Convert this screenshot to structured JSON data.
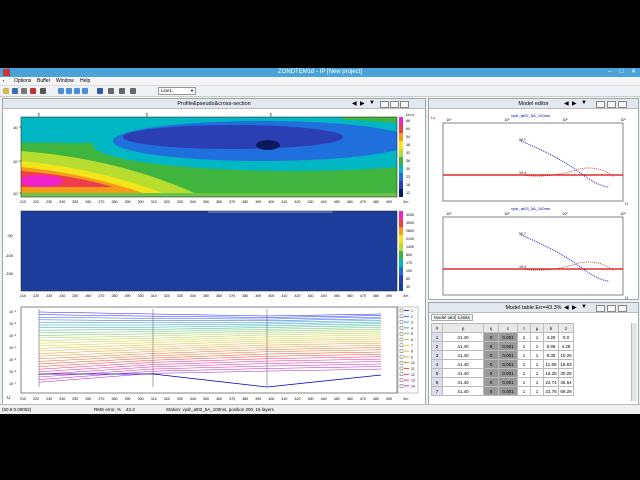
{
  "window": {
    "title": "ZONDTEM1d - IP [New project]",
    "min": "–",
    "max": "□",
    "close": "✕"
  },
  "menu": {
    "items": [
      "Options",
      "Buffer",
      "Window",
      "Help"
    ]
  },
  "toolbar": {
    "line_combo": "Line1"
  },
  "profile_panel": {
    "title": "Profile&pseudo&cross-section",
    "x_ticks": [
      "210",
      "220",
      "230",
      "240",
      "250",
      "260",
      "270",
      "280",
      "290",
      "300",
      "310",
      "320",
      "330",
      "340",
      "350",
      "360",
      "370",
      "380",
      "390",
      "400",
      "410",
      "420",
      "430",
      "440",
      "450",
      "460",
      "470",
      "480",
      "490"
    ],
    "x_unit": "Xm",
    "top_y_labels": [
      "10⁻¹",
      "10⁻²",
      "10⁻³"
    ],
    "top_legend_unit": "Ω·m",
    "top_legend": [
      "66",
      "60",
      "54",
      "48",
      "42",
      "36",
      "30",
      "23",
      "18",
      "12"
    ],
    "mid_y_labels": [
      "-50",
      "-100",
      "-150"
    ],
    "mid_legend": [
      "4200",
      "3500",
      "2800",
      "2100",
      "1400",
      "800",
      "170",
      "100",
      "60",
      "30"
    ],
    "bottom_y_labels": [
      "10⁻¹",
      "10⁻²",
      "10⁻³",
      "10⁻⁴",
      "10⁻⁵",
      "10⁻⁶",
      "10⁻⁷"
    ],
    "bottom_legend": [
      "1",
      "2",
      "3",
      "4",
      "5",
      "6",
      "7",
      "8",
      "9",
      "10",
      "11",
      "12",
      "13",
      "14"
    ],
    "marker_labels": [
      "e",
      "e",
      "e"
    ],
    "u_label": "U",
    "series_colors": [
      "#0000ff",
      "#0044ff",
      "#0088cc",
      "#00aa88",
      "#55bb44",
      "#99cc22",
      "#cccc00",
      "#ddaa00",
      "#ee8800",
      "#ee5500",
      "#ff2200",
      "#ff0066",
      "#dd00aa",
      "#aa00cc"
    ]
  },
  "model_editor": {
    "title": "Model editor",
    "top_subtitle": "vydr_at02_5A_100ms",
    "bottom_subtitle": "vydr_at03_5A_100ms",
    "x_ticks": [
      "10⁰",
      "10¹",
      "10²",
      "10³"
    ],
    "label_a": "59.7",
    "label_b": "19.4",
    "u_label": "U",
    "t_label": "t,s"
  },
  "model_table": {
    "title": "Model table Err=43.3%",
    "tabs": [
      "Model table",
      "Limits"
    ],
    "headers": [
      "#",
      "ρ",
      "η",
      "c",
      "τ",
      "μ",
      "h",
      "z"
    ],
    "rows": [
      [
        "1",
        "41.40",
        "0",
        "0.001",
        "1",
        "1",
        "4.28",
        "0.0"
      ],
      [
        "2",
        "41.40",
        "0",
        "0.001",
        "1",
        "1",
        "5.98",
        "4.28"
      ],
      [
        "3",
        "41.40",
        "0",
        "0.001",
        "1",
        "1",
        "8.35",
        "10.25"
      ],
      [
        "4",
        "41.40",
        "0",
        "0.001",
        "1",
        "1",
        "11.69",
        "18.63"
      ],
      [
        "5",
        "41.40",
        "0",
        "0.001",
        "1",
        "1",
        "16.28",
        "30.25"
      ],
      [
        "6",
        "41.40",
        "0",
        "0.001",
        "1",
        "1",
        "22.74",
        "46.54"
      ],
      [
        "7",
        "41.40",
        "0",
        "0.001",
        "1",
        "1",
        "31.76",
        "69.28"
      ]
    ]
  },
  "status": {
    "coords": "(50.9 0.00002)",
    "rms_label": "RMS error, %",
    "rms_value": "43.3",
    "station": "Station: vydr_at02_5A_100ms, position 200, 15 layers"
  }
}
